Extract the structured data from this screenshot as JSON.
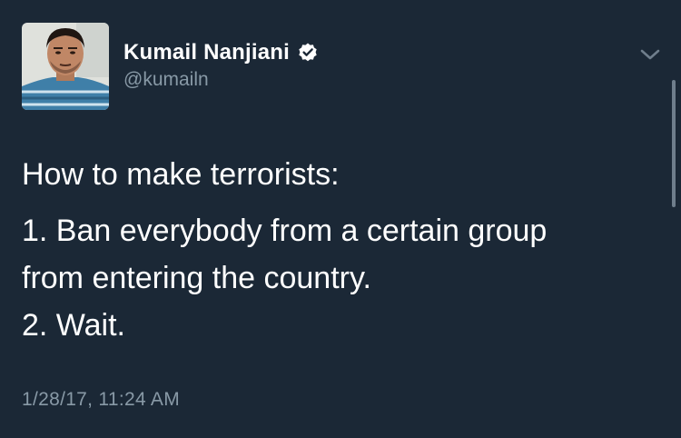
{
  "tweet": {
    "author": {
      "display_name": "Kumail Nanjiani",
      "handle": "@kumailn",
      "verified": true,
      "avatar_icon": "profile-photo"
    },
    "text_lines": [
      "How to make terrorists:",
      "1. Ban everybody from a certain group",
      "from entering the country.",
      "2. Wait."
    ],
    "timestamp": "1/28/17, 11:24 AM",
    "menu_icon": "chevron-down-icon"
  },
  "colors": {
    "background": "#1b2836",
    "primary_text": "#ffffff",
    "secondary_text": "#8899a6",
    "verified_badge": "#ffffff"
  }
}
